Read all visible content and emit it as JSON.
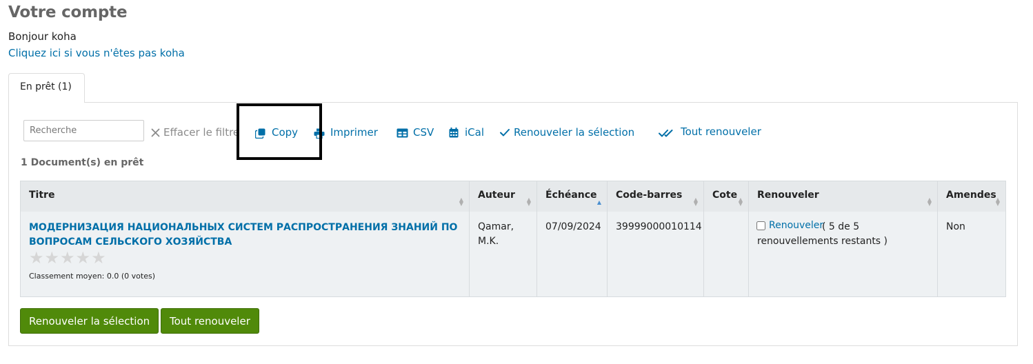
{
  "page": {
    "title": "Votre compte",
    "greeting": "Bonjour koha",
    "switch_user_link": "Cliquez ici si vous n'êtes pas koha"
  },
  "tabs": [
    {
      "label": "En prêt (1)",
      "active": true
    }
  ],
  "toolbar": {
    "search_placeholder": "Recherche",
    "clear_filter": "Effacer le filtre",
    "copy": "Copy",
    "print": "Imprimer",
    "csv": "CSV",
    "ical": "iCal",
    "renew_selected": "Renouveler la sélection",
    "renew_all": "Tout renouveler"
  },
  "count_label": "1 Document(s) en prêt",
  "table": {
    "columns": [
      "Titre",
      "Auteur",
      "Échéance",
      "Code-barres",
      "Cote",
      "Renouveler",
      "Amendes"
    ],
    "sorted_column": "Échéance",
    "rows": [
      {
        "title": "МОДЕРНИЗАЦИЯ НАЦИОНАЛЬНЫХ СИСТЕМ РАСПРОСТРАНЕНИЯ ЗНАНИЙ ПО ВОПРОСАМ СЕЛЬСКОГО ХОЗЯЙСТВА",
        "rating_stars_filled": 0,
        "rating_stars_total": 5,
        "rating_text": "Classement moyen: 0.0 (0 votes)",
        "author": "Qamar, M.K.",
        "due_date": "07/09/2024",
        "barcode": "39999000010114",
        "call_number": "",
        "renew_link": "Renouveler",
        "renew_remaining": "( 5 de 5 renouvellements restants )",
        "fines": "Non"
      }
    ]
  },
  "buttons": {
    "renew_selected": "Renouveler la sélection",
    "renew_all": "Tout renouveler"
  },
  "colors": {
    "link": "#006fa8",
    "button_bg": "#508a0a",
    "table_header_bg": "#e6e9eb",
    "table_row_bg": "#eef1f3"
  }
}
